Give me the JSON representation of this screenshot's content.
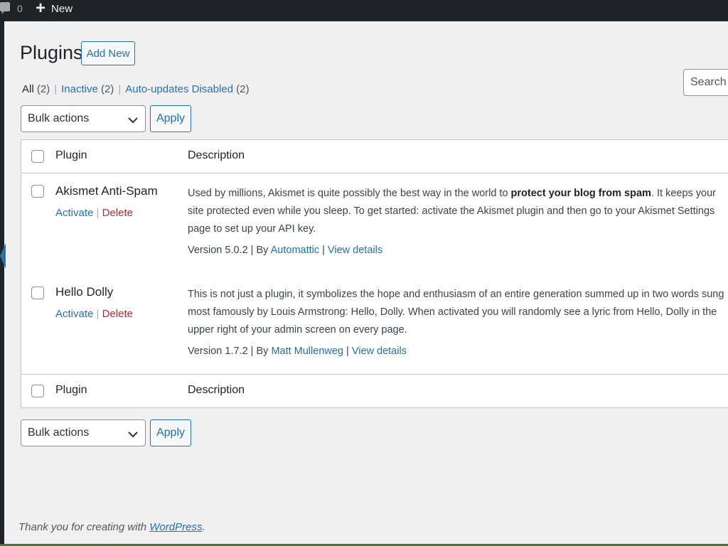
{
  "adminbar": {
    "comments_count": "0",
    "new_label": "New"
  },
  "page": {
    "title": "Plugins",
    "add_new_label": "Add New",
    "search_placeholder": "Search i"
  },
  "filters": [
    {
      "label": "All",
      "count": "(2)"
    },
    {
      "label": "Inactive",
      "count": "(2)"
    },
    {
      "label": "Auto-updates Disabled",
      "count": "(2)"
    }
  ],
  "bulk": {
    "top_label": "Bulk actions",
    "bottom_label": "Bulk actions",
    "apply_label": "Apply"
  },
  "table": {
    "columns": [
      "Plugin",
      "Description"
    ],
    "plugins": [
      {
        "name": "Akismet Anti-Spam",
        "activate": "Activate",
        "delete": "Delete",
        "desc_before": "Used by millions, Akismet is quite possibly the best way in the world to ",
        "desc_bold": "protect your blog from spam",
        "desc_after": ". It keeps your site protected even while you sleep. To get started: activate the Akismet plugin and then go to your Akismet Settings page to set up your API key.",
        "version": "Version 5.0.2",
        "by": "By",
        "author": "Automattic",
        "view_details": "View details"
      },
      {
        "name": "Hello Dolly",
        "activate": "Activate",
        "delete": "Delete",
        "desc_before": "This is not just a plugin, it symbolizes the hope and enthusiasm of an entire generation summed up in two words sung most famously by Louis Armstrong: Hello, Dolly. When activated you will randomly see a lyric from Hello, Dolly in the upper right of your admin screen on every page.",
        "desc_bold": "",
        "desc_after": "",
        "version": "Version 1.7.2",
        "by": "By",
        "author": "Matt Mullenweg",
        "view_details": "View details"
      }
    ]
  },
  "footer": {
    "thanks_text": "Thank you for creating with ",
    "wp_link": "WordPress",
    "period": "."
  },
  "colors": {
    "admin_dark": "#1d2327",
    "link_blue": "#2271b1",
    "delete_red": "#b32d2e",
    "content_bg": "#f0f0f1"
  }
}
